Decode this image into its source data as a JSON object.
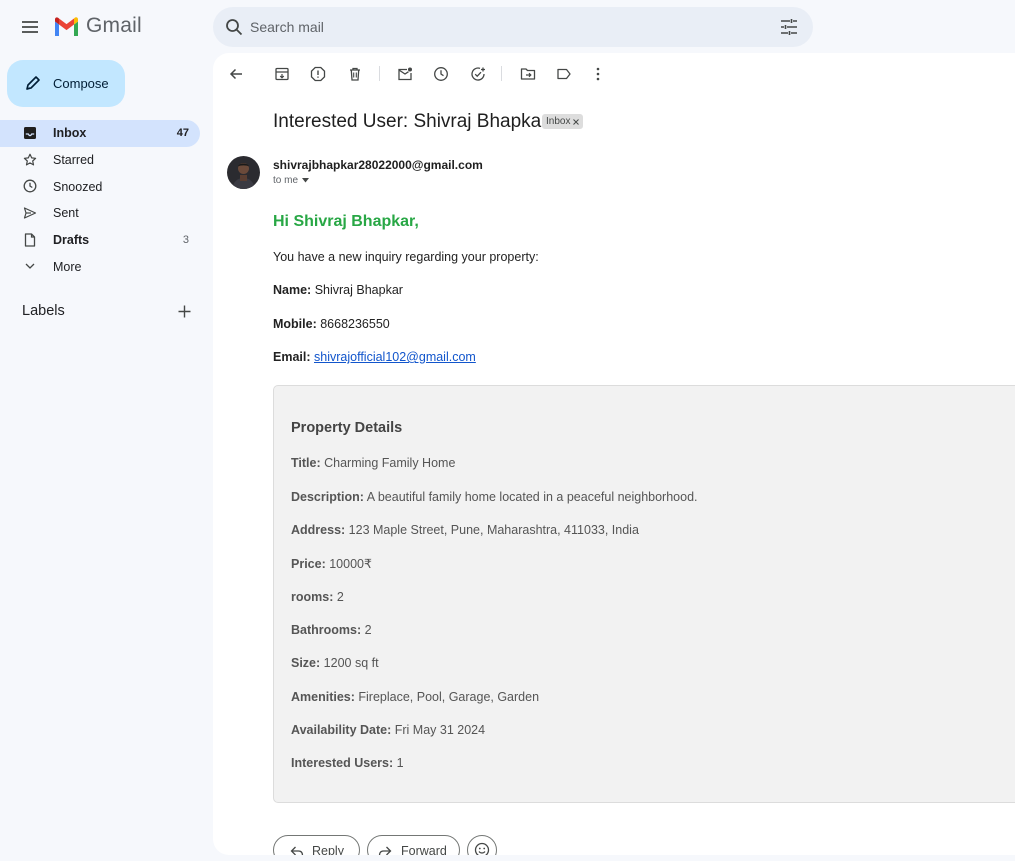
{
  "app": {
    "logo_text": "Gmail"
  },
  "search": {
    "placeholder": "Search mail"
  },
  "sidebar": {
    "compose_label": "Compose",
    "items": [
      {
        "label": "Inbox",
        "count": "47",
        "icon": "inbox-icon"
      },
      {
        "label": "Starred",
        "count": "",
        "icon": "star-icon"
      },
      {
        "label": "Snoozed",
        "count": "",
        "icon": "clock-icon"
      },
      {
        "label": "Sent",
        "count": "",
        "icon": "send-icon"
      },
      {
        "label": "Drafts",
        "count": "3",
        "icon": "draft-icon"
      },
      {
        "label": "More",
        "count": "",
        "icon": "chevron-down-icon"
      }
    ],
    "labels_title": "Labels"
  },
  "email": {
    "subject": "Interested User: Shivraj Bhapkar",
    "chip": "Inbox",
    "sender": "shivrajbhapkar28022000@gmail.com",
    "to": "to me",
    "greeting": "Hi Shivraj Bhapkar,",
    "intro": "You have a new inquiry regarding your property:",
    "name_label": "Name:",
    "name_value": " Shivraj Bhapkar",
    "mobile_label": "Mobile:",
    "mobile_value": " 8668236550",
    "email_label": "Email:",
    "email_value": "shivrajofficial102@gmail.com",
    "details": {
      "title": "Property Details",
      "rows": [
        {
          "label": "Title:",
          "value": " Charming Family Home"
        },
        {
          "label": "Description:",
          "value": " A beautiful family home located in a peaceful neighborhood."
        },
        {
          "label": "Address:",
          "value": " 123 Maple Street, Pune, Maharashtra, 411033, India"
        },
        {
          "label": "Price:",
          "value": " 10000₹"
        },
        {
          "label": "rooms:",
          "value": " 2"
        },
        {
          "label": "Bathrooms:",
          "value": " 2"
        },
        {
          "label": "Size:",
          "value": " 1200 sq ft"
        },
        {
          "label": "Amenities:",
          "value": " Fireplace, Pool, Garage, Garden"
        },
        {
          "label": "Availability Date:",
          "value": " Fri May 31 2024"
        },
        {
          "label": "Interested Users:",
          "value": " 1"
        }
      ]
    },
    "reply_label": "Reply",
    "forward_label": "Forward"
  },
  "colors": {
    "accent": "#c2e7ff",
    "active_nav": "#d3e3fd",
    "greeting": "#28a745",
    "link": "#1155cc"
  }
}
